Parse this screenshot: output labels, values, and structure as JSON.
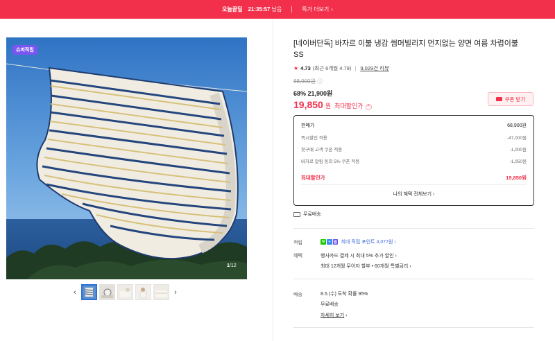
{
  "banner": {
    "deal_label": "오늘끝딜",
    "timer": "21:35:57",
    "timer_suffix": "남음",
    "more_label": "특가 더보기",
    "color": "#f2304b"
  },
  "gallery": {
    "badge": "슈퍼적립",
    "current_index": "1",
    "total": "/12",
    "prev_icon": "chevron-left-icon",
    "next_icon": "chevron-right-icon"
  },
  "product": {
    "title": "[네이버단독] 바자르 이불 냉감 썸머빌리지 먼지없는 양면 여름 차렵이불 SS",
    "rating_score": "4.73",
    "rating_recent": "(최근 6개월 4.79)",
    "review_count": "9,029건 리뷰",
    "original_price": "68,900원",
    "discount_rate": "68%",
    "sale_price": "21,900원",
    "final_price": "19,850",
    "final_unit": "원",
    "final_label": "최대할인가",
    "coupon_label": "쿠폰 받기",
    "accent_color": "#f2304b"
  },
  "price_box": {
    "rows": [
      {
        "label": "판매가",
        "value": "68,900원"
      },
      {
        "label": "즉시할인 적용",
        "value": "-47,000원"
      },
      {
        "label": "첫구매 고객 쿠폰 적용",
        "value": "-1,000원"
      },
      {
        "label": "바자르 알림 동의 5% 쿠폰 적용",
        "value": "-1,050원"
      }
    ],
    "max_label": "최대할인가",
    "max_value": "19,850원",
    "my_benefits": "나의 혜택 전체보기"
  },
  "shipping_free": "무료배송",
  "info": {
    "points_label": "적립",
    "points_text": "최대 적립 포인트 4,077원",
    "benefits_label": "혜택",
    "benefits_line1": "행사카드 결제 시 최대 5% 추가 할인",
    "benefits_line2": "최대 12개월 무이자 할부 • 60개월 특별금리",
    "delivery_label": "배송",
    "delivery_line1": "8.5.(수) 도착 확률 95%",
    "delivery_line2": "무료배송",
    "delivery_more": "자세히 보기"
  }
}
